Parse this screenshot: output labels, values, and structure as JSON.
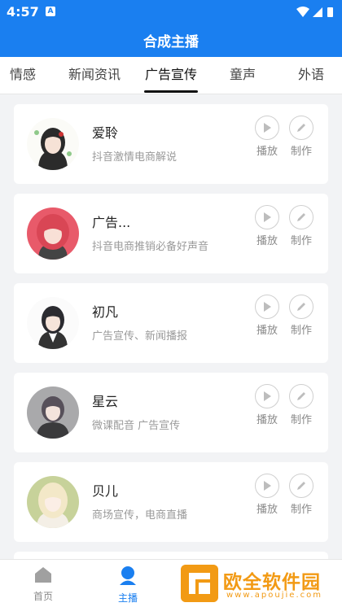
{
  "status_bar": {
    "time": "4:57",
    "notification_icon": "A"
  },
  "header": {
    "title": "合成主播"
  },
  "tabs": [
    {
      "label": "情感"
    },
    {
      "label": "新闻资讯"
    },
    {
      "label": "广告宣传"
    },
    {
      "label": "童声"
    },
    {
      "label": "外语"
    }
  ],
  "voices": [
    {
      "name": "爱聆",
      "desc": "抖音激情电商解说",
      "play_label": "播放",
      "make_label": "制作"
    },
    {
      "name": "广告...",
      "desc": "抖音电商推销必备好声音",
      "play_label": "播放",
      "make_label": "制作"
    },
    {
      "name": "初凡",
      "desc": "广告宣传、新闻播报",
      "play_label": "播放",
      "make_label": "制作"
    },
    {
      "name": "星云",
      "desc": "微课配音  广告宣传",
      "play_label": "播放",
      "make_label": "制作"
    },
    {
      "name": "贝儿",
      "desc": "商场宣传，电商直播",
      "play_label": "播放",
      "make_label": "制作"
    }
  ],
  "bottom_nav": [
    {
      "label": "首页",
      "icon": "home-icon"
    },
    {
      "label": "主播",
      "icon": "anchor-icon"
    }
  ],
  "watermark": {
    "text": "欧全软件园",
    "sub": "www.apoujie.com"
  },
  "colors": {
    "primary": "#1a7ff0",
    "background": "#f2f3f5",
    "watermark": "#f29a14"
  }
}
